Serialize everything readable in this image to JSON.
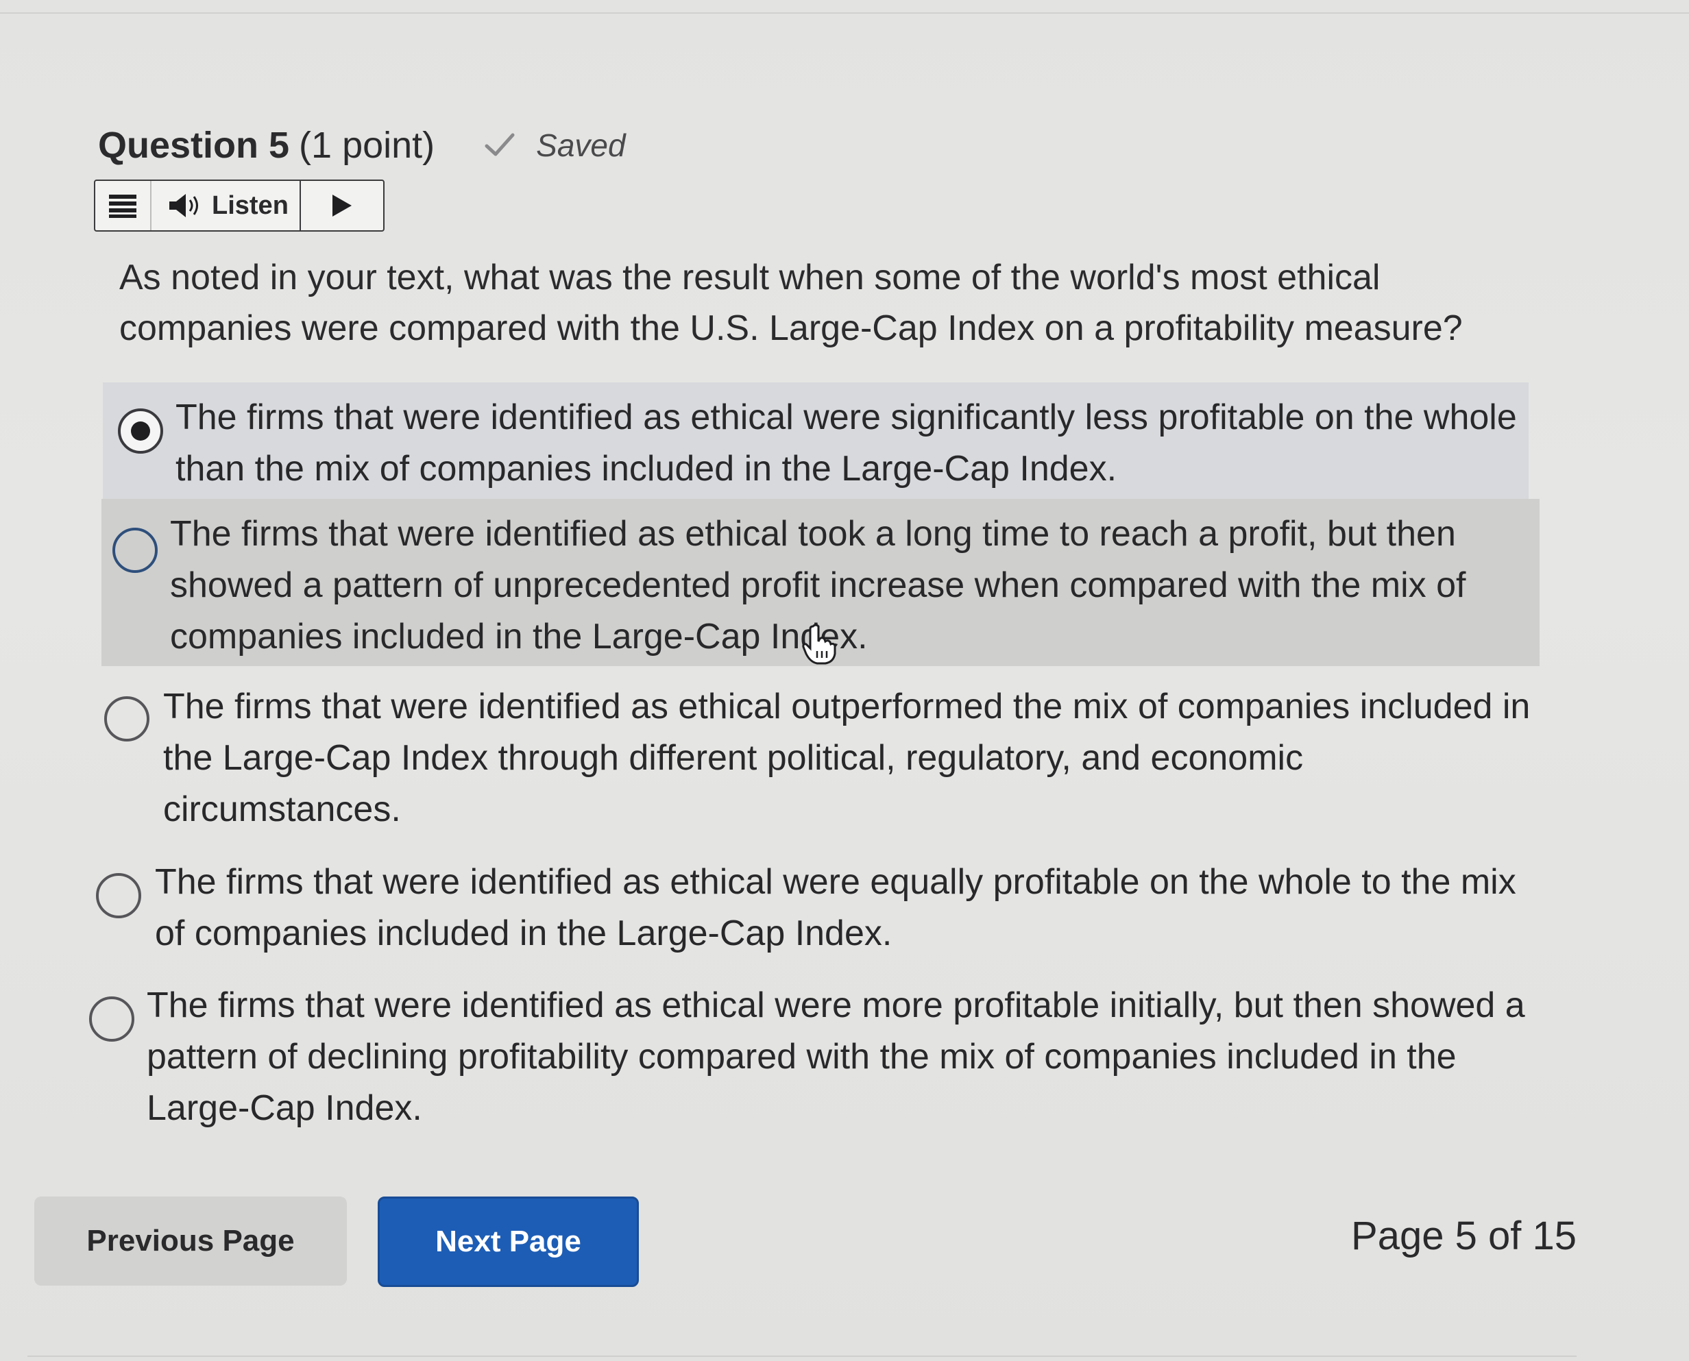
{
  "question": {
    "title": "Question 5",
    "points": "(1 point)",
    "saved_label": "Saved",
    "text": "As noted in your text, what was the result when some of the world's most ethical companies were compared with the U.S. Large-Cap Index on a profitability measure?"
  },
  "toolbar": {
    "menu_icon": "hamburger-menu-icon",
    "listen_label": "Listen",
    "speaker_icon": "speaker-icon",
    "play_icon": "play-icon"
  },
  "options": [
    {
      "label": "The firms that were identified as ethical were significantly less profitable on the whole than the mix of companies included in the Large-Cap Index.",
      "selected": true
    },
    {
      "label": "The firms that were identified as ethical took a long time to reach a profit, but then showed a pattern of unprecedented profit increase when compared with the mix of companies included in the Large-Cap Index.",
      "selected": false
    },
    {
      "label": "The firms that were identified as ethical outperformed the mix of companies included in the Large-Cap Index through different political, regulatory, and economic circumstances.",
      "selected": false
    },
    {
      "label": "The firms that were identified as ethical were equally profitable on the whole to the mix of companies included in the Large-Cap Index.",
      "selected": false
    },
    {
      "label": "The firms that were identified as ethical were more profitable initially, but then showed a pattern of declining profitability compared with the mix of companies included in the Large-Cap Index.",
      "selected": false
    }
  ],
  "navigation": {
    "previous_label": "Previous Page",
    "next_label": "Next Page",
    "page_indicator": "Page 5 of 15"
  },
  "colors": {
    "next_button": "#1d5db5",
    "selected_row": "#d7d9dc",
    "hover_row": "#cfcfcd"
  }
}
